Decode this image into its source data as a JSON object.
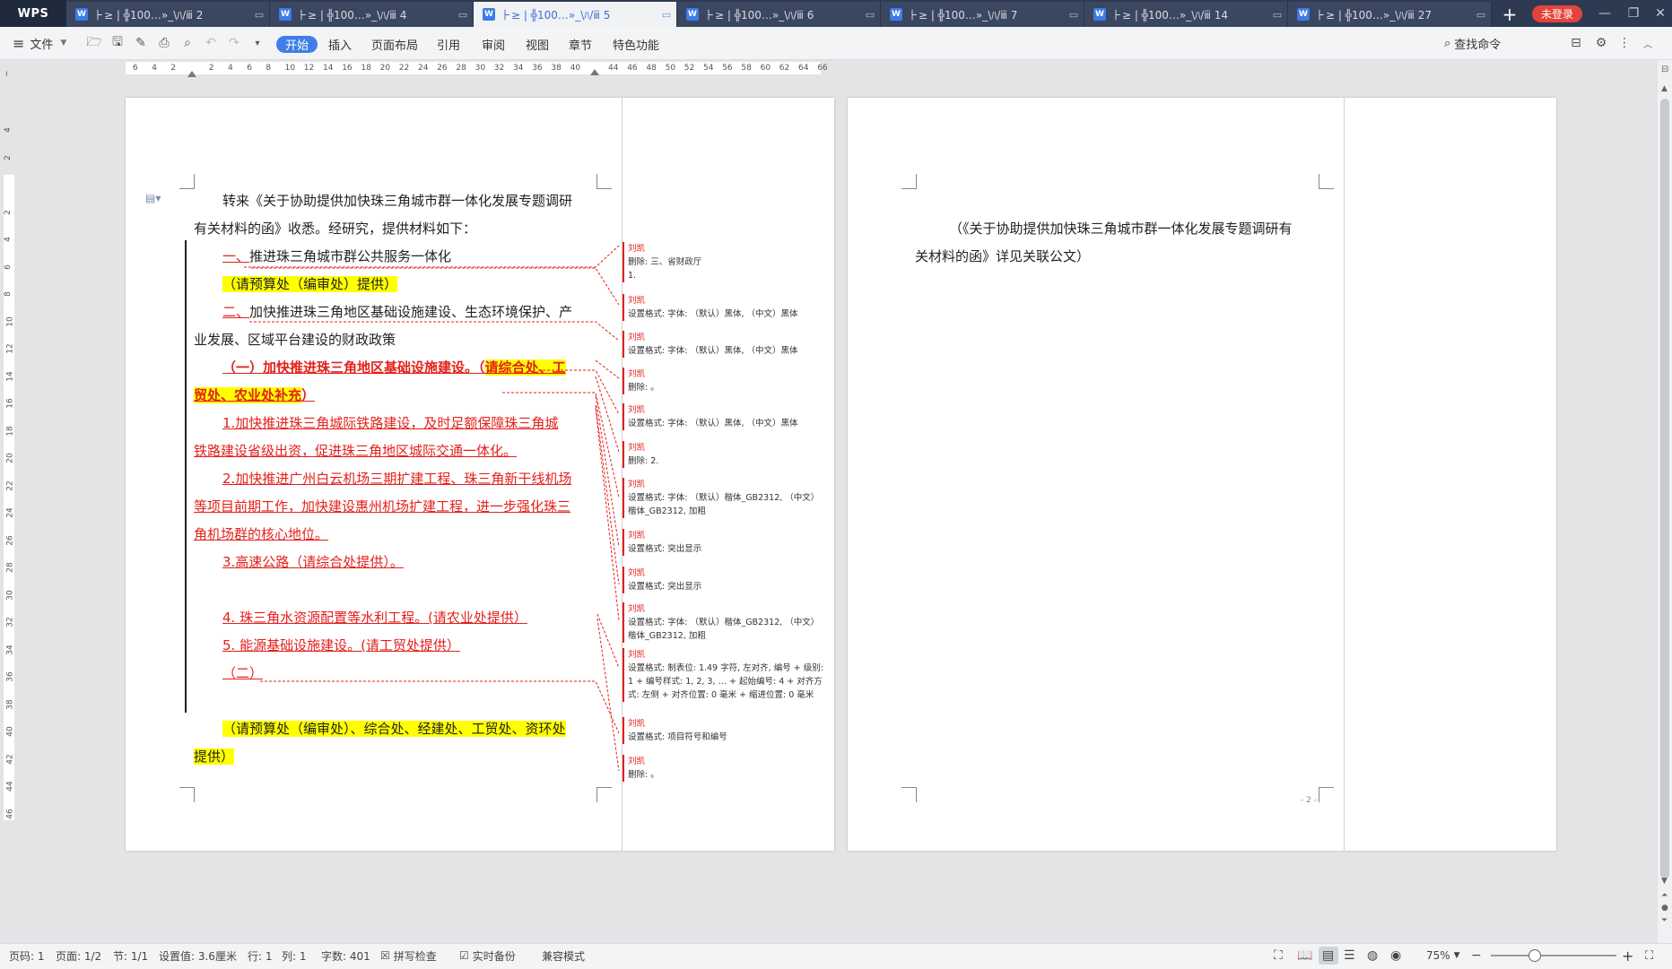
{
  "app": {
    "logo": "WPS",
    "login": "未登录"
  },
  "tabs": [
    {
      "label": "⺊≥ | ╬100…»_\\ﾊ/ⅲ 2",
      "active": false
    },
    {
      "label": "⺊≥ | ╬100…»_\\ﾊ/ⅲ 4",
      "active": false
    },
    {
      "label": "⺊≥ | ╬100…»_\\ﾊ/ⅲ 5",
      "active": true
    },
    {
      "label": "⺊≥ | ╬100…»_\\ﾊ/ⅲ 6",
      "active": false
    },
    {
      "label": "⺊≥ | ╬100…»_\\ﾊ/ⅲ 7",
      "active": false
    },
    {
      "label": "⺊≥ | ╬100…»_\\ﾊ/ⅲ 14",
      "active": false
    },
    {
      "label": "⺊≥ | ╬100…»_\\ﾊ/ⅲ 27",
      "active": false
    }
  ],
  "menu": {
    "file": "文件",
    "tabs": [
      "开始",
      "插入",
      "页面布局",
      "引用",
      "审阅",
      "视图",
      "章节",
      "特色功能"
    ],
    "search": "查找命令"
  },
  "ruler": {
    "h": [
      "6",
      "4",
      "2",
      "",
      "2",
      "4",
      "6",
      "8",
      "10",
      "12",
      "14",
      "16",
      "18",
      "20",
      "22",
      "24",
      "26",
      "28",
      "30",
      "32",
      "34",
      "36",
      "38",
      "40",
      "",
      "44",
      "46",
      "48",
      "50",
      "52",
      "54",
      "56",
      "58",
      "60",
      "62",
      "64",
      "66"
    ],
    "v": [
      "4",
      "2",
      "",
      "2",
      "4",
      "6",
      "8",
      "10",
      "12",
      "14",
      "16",
      "18",
      "20",
      "22",
      "24",
      "26",
      "28",
      "30",
      "32",
      "34",
      "36",
      "38",
      "40",
      "42",
      "44",
      "46"
    ]
  },
  "page1": {
    "lines": [
      {
        "text": "转来《关于协助提供加快珠三角城市群一体化发展专题调研",
        "style": "normal"
      },
      {
        "text": "有关材料的函》收悉。经研究，提供材料如下：",
        "style": "normal"
      },
      {
        "text_a": "一、",
        "text_b": "推进珠三角城市群公共服务一体化",
        "style": "mixed1"
      },
      {
        "text": "（请预算处（编审处）提供）",
        "style": "hl"
      },
      {
        "text_a": "二、",
        "text_b": "加快推进珠三角地区基础设施建设、生态环境保护、产",
        "style": "mixed1"
      },
      {
        "text": "业发展、区域平台建设的财政政策",
        "style": "normal"
      },
      {
        "text_a": "（一）加快推进珠三角地区基础设施建设。（",
        "text_b": "请综合处、工",
        "style": "mixed2"
      },
      {
        "text_a": "贸处、农业处补充",
        "text_b": "）",
        "style": "mixed3"
      },
      {
        "text": "1.加快推进珠三角城际铁路建设，及时足额保障珠三角城",
        "style": "red"
      },
      {
        "text": "铁路建设省级出资，促进珠三角地区城际交通一体化。",
        "style": "red"
      },
      {
        "text": "2.加快推进广州白云机场三期扩建工程、珠三角新干线机场",
        "style": "red"
      },
      {
        "text": "等项目前期工作，加快建设惠州机场扩建工程，进一步强化珠三",
        "style": "red"
      },
      {
        "text": "角机场群的核心地位。",
        "style": "red"
      },
      {
        "text": "3.高速公路（请综合处提供）。",
        "style": "red"
      },
      {
        "text": "",
        "style": "normal"
      },
      {
        "text": "4.   珠三角水资源配置等水利工程。(请农业处提供）",
        "style": "red"
      },
      {
        "text": "5.   能源基础设施建设。(请工贸处提供）",
        "style": "red"
      },
      {
        "text": "（二）",
        "style": "red"
      },
      {
        "text": "",
        "style": "normal"
      },
      {
        "text": "（请预算处（编审处）、综合处、经建处、工贸处、资环处",
        "style": "hl"
      },
      {
        "text": "提供）",
        "style": "hl"
      }
    ]
  },
  "comments": [
    {
      "author": "刘凯",
      "text": "删除: 三、省财政厅\n1."
    },
    {
      "author": "刘凯",
      "text": "设置格式: 字体: （默认）黑体, （中文）黑体"
    },
    {
      "author": "刘凯",
      "text": "设置格式: 字体: （默认）黑体, （中文）黑体"
    },
    {
      "author": "刘凯",
      "text": "删除: 。"
    },
    {
      "author": "刘凯",
      "text": "设置格式: 字体: （默认）黑体, （中文）黑体"
    },
    {
      "author": "刘凯",
      "text": "删除: 2."
    },
    {
      "author": "刘凯",
      "text": "设置格式: 字体: （默认）楷体_GB2312, （中文）楷体_GB2312, 加粗"
    },
    {
      "author": "刘凯",
      "text": "设置格式: 突出显示"
    },
    {
      "author": "刘凯",
      "text": "设置格式: 突出显示"
    },
    {
      "author": "刘凯",
      "text": "设置格式: 字体: （默认）楷体_GB2312, （中文）楷体_GB2312, 加粗"
    },
    {
      "author": "刘凯",
      "text": "设置格式: 制表位: 1.49 字符, 左对齐, 编号 + 级别: 1 + 编号样式: 1, 2, 3, … + 起始编号: 4 + 对齐方式: 左侧 + 对齐位置: 0 毫米 + 缩进位置: 0 毫米"
    },
    {
      "author": "刘凯",
      "text": "设置格式: 项目符号和编号"
    },
    {
      "author": "刘凯",
      "text": "删除: 。"
    }
  ],
  "page2": {
    "line1": "（《关于协助提供加快珠三角城市群一体化发展专题调研有",
    "line2": "关材料的函》详见关联公文）",
    "page_num": "- 2 -"
  },
  "status": {
    "page_code": "页码: 1",
    "page": "页面: 1/2",
    "section": "节: 1/1",
    "setting": "设置值: 3.6厘米",
    "row": "行: 1",
    "col": "列: 1",
    "words": "字数: 401",
    "spell": "拼写检查",
    "backup": "实时备份",
    "compat": "兼容模式",
    "zoom": "75%"
  },
  "colors": {
    "accent": "#3f7de8",
    "revision": "#e3201b",
    "highlight": "#ffff00",
    "titlebar": "#2e3a52"
  }
}
